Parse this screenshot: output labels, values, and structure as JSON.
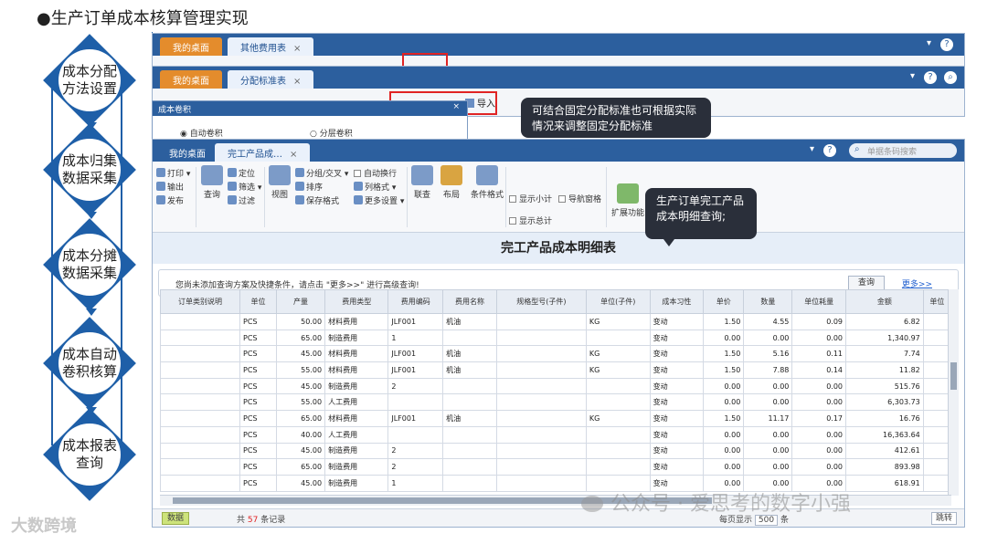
{
  "slide": {
    "title": "●生产订单成本核算管理实现"
  },
  "flow": {
    "steps": [
      {
        "label": "成本分配方法设置"
      },
      {
        "label": "成本归集数据采集"
      },
      {
        "label": "成本分摊数据采集"
      },
      {
        "label": "成本自动卷积核算"
      },
      {
        "label": "成本报表查询"
      }
    ]
  },
  "watermark_left": "大数跨境",
  "watermark_right": "公众号 · 爱思考的数字小强",
  "win1": {
    "tabs": [
      "我的桌面",
      "其他费用表"
    ]
  },
  "win2": {
    "tabs": [
      "我的桌面",
      "分配标准表"
    ],
    "import_label": "导入"
  },
  "dialog": {
    "title": "成本卷积",
    "opt1": "自动卷积",
    "opt2": "分层卷积"
  },
  "callout1": "可结合固定分配标准也可根据实际情况来调整固定分配标准",
  "callout2": "生产订单完工产品成本明细查询;",
  "main": {
    "tabs": [
      "我的桌面",
      "完工产品成…"
    ],
    "search_placeholder": "单据条码搜索",
    "ribbon": {
      "print": "打印",
      "output": "输出",
      "publish": "发布",
      "query": "查询",
      "locate": "定位",
      "filter": "筛选",
      "filter2": "过滤",
      "view": "视图",
      "group": "分组/交叉",
      "sort": "排序",
      "save_format": "保存格式",
      "auto_wrap": "自动换行",
      "col_format": "列格式",
      "more_settings": "更多设置",
      "linked": "联查",
      "layout": "布局",
      "cond_format": "条件格式",
      "show_subtotal": "显示小计",
      "nav_pane": "导航窗格",
      "show_total": "显示总计",
      "extend": "扩展功能"
    },
    "report_title": "完工产品成本明细表",
    "query_msg": "您尚未添加查询方案及快捷条件，请点击 \"更多>>\" 进行高级查询!",
    "query_btn": "查询",
    "more_link": "更多>>",
    "columns": [
      "订单类别说明",
      "单位",
      "产量",
      "费用类型",
      "费用编码",
      "费用名称",
      "规格型号(子件)",
      "单位(子件)",
      "成本习性",
      "单价",
      "数量",
      "单位耗量",
      "金额",
      "单位"
    ],
    "rows": [
      [
        "",
        "PCS",
        "50.00",
        "材料费用",
        "JLF001",
        "机油",
        "",
        "KG",
        "变动",
        "1.50",
        "4.55",
        "0.09",
        "6.82",
        ""
      ],
      [
        "",
        "PCS",
        "65.00",
        "制造费用",
        "1",
        "",
        "",
        "",
        "变动",
        "0.00",
        "0.00",
        "0.00",
        "1,340.97",
        ""
      ],
      [
        "",
        "PCS",
        "45.00",
        "材料费用",
        "JLF001",
        "机油",
        "",
        "KG",
        "变动",
        "1.50",
        "5.16",
        "0.11",
        "7.74",
        ""
      ],
      [
        "",
        "PCS",
        "55.00",
        "材料费用",
        "JLF001",
        "机油",
        "",
        "KG",
        "变动",
        "1.50",
        "7.88",
        "0.14",
        "11.82",
        ""
      ],
      [
        "",
        "PCS",
        "45.00",
        "制造费用",
        "2",
        "",
        "",
        "",
        "变动",
        "0.00",
        "0.00",
        "0.00",
        "515.76",
        ""
      ],
      [
        "",
        "PCS",
        "55.00",
        "人工费用",
        "",
        "",
        "",
        "",
        "变动",
        "0.00",
        "0.00",
        "0.00",
        "6,303.73",
        ""
      ],
      [
        "",
        "PCS",
        "65.00",
        "材料费用",
        "JLF001",
        "机油",
        "",
        "KG",
        "变动",
        "1.50",
        "11.17",
        "0.17",
        "16.76",
        ""
      ],
      [
        "",
        "PCS",
        "40.00",
        "人工费用",
        "",
        "",
        "",
        "",
        "变动",
        "0.00",
        "0.00",
        "0.00",
        "16,363.64",
        ""
      ],
      [
        "",
        "PCS",
        "45.00",
        "制造费用",
        "2",
        "",
        "",
        "",
        "变动",
        "0.00",
        "0.00",
        "0.00",
        "412.61",
        ""
      ],
      [
        "",
        "PCS",
        "65.00",
        "制造费用",
        "2",
        "",
        "",
        "",
        "变动",
        "0.00",
        "0.00",
        "0.00",
        "893.98",
        ""
      ],
      [
        "",
        "PCS",
        "45.00",
        "制造费用",
        "1",
        "",
        "",
        "",
        "变动",
        "0.00",
        "0.00",
        "0.00",
        "618.91",
        ""
      ]
    ],
    "status": {
      "data_btn": "数据",
      "rec_prefix": "共 ",
      "rec_count": "57",
      "rec_suffix": " 条记录",
      "per_page_label": "每页显示",
      "per_page_value": "500",
      "per_page_unit": "条",
      "jump": "跳转"
    }
  }
}
